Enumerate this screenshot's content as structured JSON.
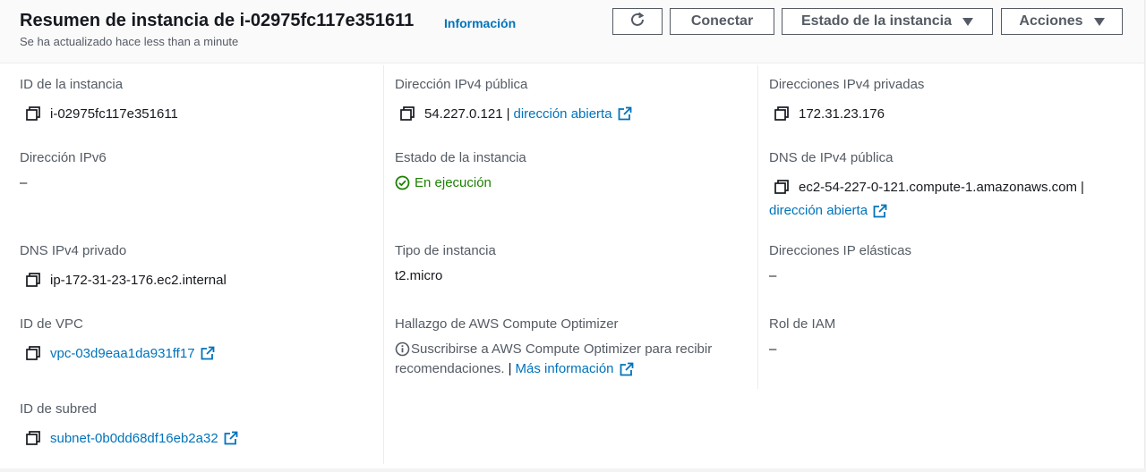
{
  "header": {
    "title": "Resumen de instancia de i-02975fc117e351611",
    "info_link": "Información",
    "subtitle": "Se ha actualizado hace less than a minute",
    "connect_label": "Conectar",
    "instance_state_label": "Estado de la instancia",
    "actions_label": "Acciones"
  },
  "fields": {
    "instance_id": {
      "label": "ID de la instancia",
      "value": "i-02975fc117e351611"
    },
    "public_ipv4": {
      "label": "Dirección IPv4 pública",
      "value": "54.227.0.121",
      "sep": "|",
      "link": "dirección abierta"
    },
    "private_ipv4": {
      "label": "Direcciones IPv4 privadas",
      "value": "172.31.23.176"
    },
    "ipv6": {
      "label": "Dirección IPv6",
      "value": "–"
    },
    "instance_state": {
      "label": "Estado de la instancia",
      "value": "En ejecución"
    },
    "public_dns": {
      "label": "DNS de IPv4 pública",
      "value": "ec2-54-227-0-121.compute-1.amazonaws.com",
      "sep": "|",
      "link": "dirección abierta"
    },
    "private_dns": {
      "label": "DNS IPv4 privado",
      "value": "ip-172-31-23-176.ec2.internal"
    },
    "instance_type": {
      "label": "Tipo de instancia",
      "value": "t2.micro"
    },
    "elastic_ips": {
      "label": "Direcciones IP elásticas",
      "value": "–"
    },
    "vpc_id": {
      "label": "ID de VPC",
      "value": "vpc-03d9eaa1da931ff17"
    },
    "compute_optimizer": {
      "label": "Hallazgo de AWS Compute Optimizer",
      "line1": "Suscribirse a AWS Compute Optimizer para recibir",
      "line2": "recomendaciones.",
      "sep": "|",
      "link": "Más información"
    },
    "iam_role": {
      "label": "Rol de IAM",
      "value": "–"
    },
    "subnet_id": {
      "label": "ID de subred",
      "value": "subnet-0b0dd68df16eb2a32"
    }
  },
  "icons": {
    "copy": "copy-icon",
    "external": "external-link-icon",
    "refresh": "refresh-icon",
    "status": "check-circle-icon",
    "info": "info-icon"
  },
  "colors": {
    "link": "#0073bb",
    "running": "#1d8102"
  }
}
